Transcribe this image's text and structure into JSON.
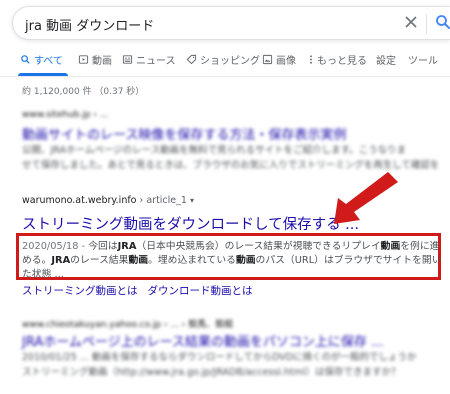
{
  "search": {
    "query": "jra 動画 ダウンロード"
  },
  "tabs": [
    {
      "label": "すべて",
      "icon": "search-icon"
    },
    {
      "label": "動画",
      "icon": "video-icon"
    },
    {
      "label": "ニュース",
      "icon": "news-icon"
    },
    {
      "label": "ショッピング",
      "icon": "tag-icon"
    },
    {
      "label": "画像",
      "icon": "image-icon"
    },
    {
      "label": "もっと見る",
      "icon": "more-vert-icon"
    },
    {
      "label": "設定"
    },
    {
      "label": "ツール"
    }
  ],
  "stats": "約 1,120,000 件 （0.37 秒）",
  "blurred_result_1": {
    "url": "www.sitehub.jp › ...",
    "title": "動画サイトのレース映像を保存する方法・保存表示実例",
    "snippet_1": "公開、JRAホームページのレース動画を無料で見られるサイトをご紹介します。こうなりま",
    "snippet_2": "せて保存しました。あとで見るときは、ブラウザのお気に入りでストリーミングを再生して確認を"
  },
  "main_result": {
    "url_domain": "warumono.at.webry.info",
    "url_path": " › article_1",
    "title": "ストリーミング動画をダウンロードして保存する ...",
    "snippet_line1_date": "2020/05/18 - ",
    "snippet_line1_a": "今回は",
    "snippet_line1_b": "JRA",
    "snippet_line1_c": "（日本中央競馬会）のレース結果が視聴できるリプレイ",
    "snippet_line1_d": "動画",
    "snippet_line1_e": "を例に進",
    "snippet_line2_a": "める。",
    "snippet_line2_b": "JRA",
    "snippet_line2_c": "のレース結果",
    "snippet_line2_d": "動画",
    "snippet_line2_e": "。埋め込まれている",
    "snippet_line2_f": "動画",
    "snippet_line2_g": "のパス（URL）はブラウザでサイトを開い",
    "snippet_line3": "た状態 ...",
    "sitelink_1": "ストリーミング動画とは",
    "sitelink_2": "ダウンロード動画とは"
  },
  "blurred_result_2": {
    "url": "www.chieotakuyan.yahoo.co.jp › ... › 競馬、競艇",
    "title": "JRAホームページ上のレース結果の動画をパソコン上に保存 ...",
    "snippet_1": "2010/01/25 ... 動画を保存するならダウンロードしてからDVDに焼くのが一般的でしょうか",
    "snippet_2": "ストリーミング動画（http://www.jra.go.jp/JRADB/accessI.html）は保存できますか？"
  },
  "colors": {
    "link": "#1a0dab",
    "accent": "#1a73e8",
    "highlight": "#d11a1a"
  }
}
